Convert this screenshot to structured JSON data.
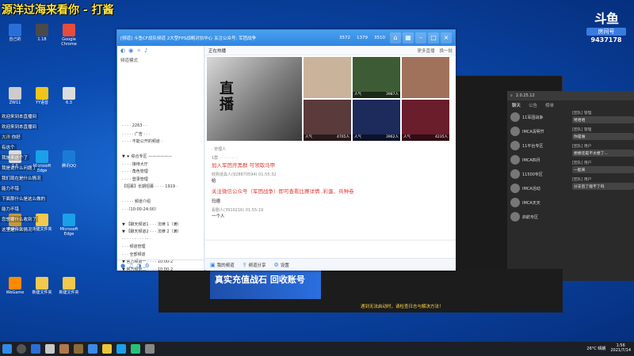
{
  "overlay": {
    "title": "源洋过海来看你 - 打酱"
  },
  "brand": {
    "logo": "斗鱼",
    "sub": "房间号",
    "room": "9437178"
  },
  "desktop_icons": [
    {
      "label": "自己的",
      "color": "#2b6fd6"
    },
    {
      "label": "1.18",
      "color": "#4a4a4a"
    },
    {
      "label": "Google Chrome",
      "color": "#e74c3c"
    },
    {
      "label": "ZW11",
      "color": "#cccccc"
    },
    {
      "label": "YY语音",
      "color": "#f0c419"
    },
    {
      "label": "6.3",
      "color": "#dddddd"
    },
    {
      "label": "1.6",
      "color": "#dddddd"
    },
    {
      "label": "Microsoft Edge",
      "color": "#1aa0e8"
    },
    {
      "label": "腾讯QQ",
      "color": "#1a7bd6"
    },
    {
      "label": "英雄联盟",
      "color": "#c49a3a"
    },
    {
      "label": "新建文件夹",
      "color": "#f2c94c"
    },
    {
      "label": "Microsoft Edge",
      "color": "#1aa0e8"
    },
    {
      "label": "WeGame",
      "color": "#ff8a00"
    },
    {
      "label": "新建文件夹",
      "color": "#f2c94c"
    },
    {
      "label": "新建文件夹",
      "color": "#f2c94c"
    }
  ],
  "chat_overlay": [
    {
      "user": "",
      "text": "欢迎来到本直播间"
    },
    {
      "user": "",
      "text": "欢迎来到本直播间"
    },
    {
      "user": "大洋",
      "text": "你好"
    },
    {
      "user": "",
      "text": "有这个"
    },
    {
      "user": "",
      "text": "我是来这个了"
    },
    {
      "user": "",
      "text": "我是说什么问题了"
    },
    {
      "user": "",
      "text": "我们现在是什么情况"
    },
    {
      "user": "",
      "text": "能力不错"
    },
    {
      "user": "",
      "text": "下面那什么是这么做的"
    },
    {
      "user": "",
      "text": "能力不错"
    },
    {
      "user": "",
      "text": "您想要什么收到了"
    },
    {
      "user": "",
      "text": "这里是什么情况"
    }
  ],
  "main_window": {
    "title": "[频道] 斗鱼CF战队频道 2大型FPS战略对抗中心 关注公众号: 军团战争",
    "stats": [
      "3572",
      "1379",
      "3510"
    ],
    "left_mode": "频道模式",
    "tree": [
      "· · · · 2263 · ·",
      "· · · · · 广告 · · ·",
      "· · · · 不能公开的频道 ·",
      "",
      "▼ ★ 综合专区 ——————",
      "· · · · 接待大厅",
      "· · · · 角色管理",
      "· · · · 登录管理",
      "【招募】长期招募 · · · · 1919 ·",
      "",
      "· · · · · 频道介绍",
      "· · ·〔10:00-24:00〕",
      "",
      "▼ 【聊天频道1 · · · 法律 1（满）",
      "▼ 【聊天频道2 · · · 法律 2（满）",
      "· · · · · · · · · · · ·",
      "· · · 频道管理",
      "· · · 全部频道",
      "▼ 官方频道一 · · · · 10:00-2",
      "▼ 官方频道二 · · · · 10:00-2"
    ],
    "hot_title": "正在热播",
    "hot_more": "更多直播",
    "hot_next": "换一批",
    "big_thumb_label": "直播",
    "thumbs": [
      {
        "cap": "",
        "viewers": "",
        "bg": "#c9b49b"
      },
      {
        "cap": "人气",
        "viewers": "3987人",
        "bg": "#3d5c35"
      },
      {
        "cap": "",
        "viewers": "",
        "bg": "#a0725c"
      },
      {
        "cap": "人气",
        "viewers": "4705人",
        "bg": "#5a3a3a"
      },
      {
        "cap": "人气",
        "viewers": "3962人",
        "bg": "#1c2a5c"
      },
      {
        "cap": "人气",
        "viewers": "4235人",
        "bg": "#6a1d2a"
      }
    ],
    "messages": [
      {
        "meta": "· 管理人",
        "text": ""
      },
      {
        "meta": "1群 · · · · · · · ·",
        "text": "加入军团开黑群 可领取马甲"
      },
      {
        "meta": "收购道具人(928870594) 01:55:32",
        "text": "给"
      },
      {
        "meta": "",
        "text": "关注微信公众号（军团战争）即可查看比赛详情 .彩蛋、兵种卷"
      },
      {
        "meta": "",
        "text": "玛德"
      },
      {
        "meta": "看剧人(3910216) 01:55:19",
        "text": "一个人"
      }
    ],
    "bottom_tools": [
      "我的频道",
      "频道分享",
      "设置"
    ]
  },
  "right_window": {
    "head": "2.0.25.12",
    "tabs": [
      "聊天",
      "公告",
      "榜单"
    ],
    "list": [
      {
        "name": "11军团战争"
      },
      {
        "name": "IMCA清明节"
      },
      {
        "name": "11平台专区"
      },
      {
        "name": "IMCA四月"
      },
      {
        "name": "11500专区"
      },
      {
        "name": "IMCA活动"
      },
      {
        "name": "IMCA天天"
      },
      {
        "name": "启航专区"
      }
    ],
    "chat": [
      {
        "who": "[团队] 管理",
        "text": "哈哈哈"
      },
      {
        "who": "[团队] 管理",
        "text": "你是谁"
      },
      {
        "who": "[团队] 用户",
        "text": "想想还是不太想了..."
      },
      {
        "who": "[团队] 用户",
        "text": "一起来"
      },
      {
        "who": "[团队] 用户",
        "text": "分支后了能不了吗"
      }
    ]
  },
  "back_window": {
    "banner": "真实充值战石 回收账号",
    "note": "遇到无法启动时，请检查日志与解决方法！"
  },
  "taskbar": {
    "icons": [
      "#2b6fd6",
      "#c9c9c9",
      "#b0784b",
      "#8a6a3a",
      "#3a8ae8",
      "#e8c53a",
      "#1aa0e8",
      "#27c27a",
      "#888888"
    ],
    "weather": "26°C 晴朗",
    "time": "1:56",
    "date": "2021/7/14"
  }
}
